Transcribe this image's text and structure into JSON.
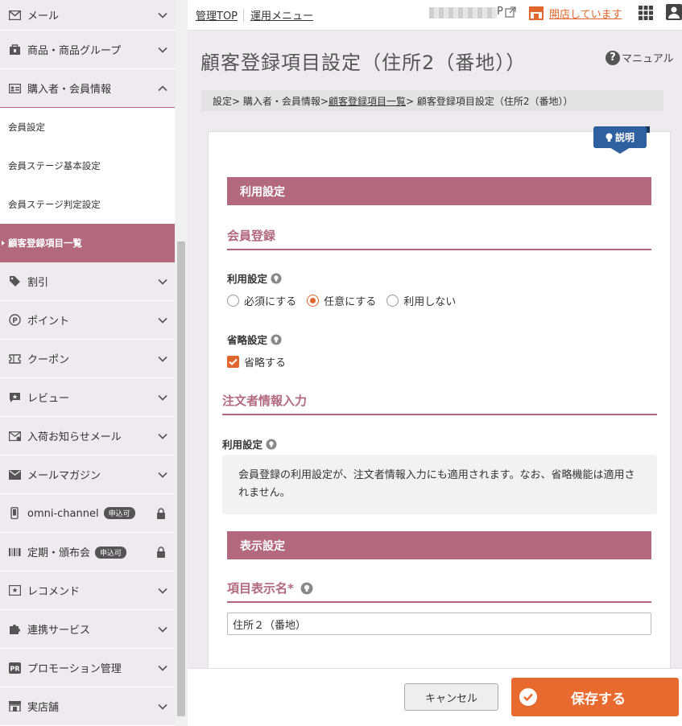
{
  "sidebar": {
    "items_top": [
      {
        "label": "メール",
        "icon": "mail-icon"
      },
      {
        "label": "商品・商品グループ",
        "icon": "product-bag-icon"
      },
      {
        "label": "購入者・会員情報",
        "icon": "member-card-icon"
      }
    ],
    "sub_items": [
      {
        "label": "会員設定"
      },
      {
        "label": "会員ステージ基本設定"
      },
      {
        "label": "会員ステージ判定設定"
      },
      {
        "label": "顧客登録項目一覧"
      }
    ],
    "items_bottom": [
      {
        "label": "割引",
        "icon": "tag-icon"
      },
      {
        "label": "ポイント",
        "icon": "point-icon"
      },
      {
        "label": "クーポン",
        "icon": "coupon-icon"
      },
      {
        "label": "レビュー",
        "icon": "review-icon"
      },
      {
        "label": "入荷お知らせメール",
        "icon": "restock-mail-icon"
      },
      {
        "label": "メールマガジン",
        "icon": "mail-magazine-icon"
      },
      {
        "label": "omni-channel",
        "icon": "phone-icon",
        "badge": "申込可"
      },
      {
        "label": "定期・頒布会",
        "icon": "subscription-icon",
        "badge": "申込可"
      },
      {
        "label": "レコメンド",
        "icon": "recommend-icon"
      },
      {
        "label": "連携サービス",
        "icon": "puzzle-icon"
      },
      {
        "label": "プロモーション管理",
        "icon": "pr-icon"
      },
      {
        "label": "実店舗",
        "icon": "store-front-icon"
      }
    ]
  },
  "topbar": {
    "admin_top": "管理TOP",
    "operations_menu": "運用メニュー",
    "shop_suffix": "P",
    "store_status": "開店しています"
  },
  "header": {
    "title": "顧客登録項目設定（住所2（番地））",
    "manual": "マニュアル"
  },
  "breadcrumb": {
    "part1": "設定> 購入者・会員情報> ",
    "link": "顧客登録項目一覧",
    "part2": "> 顧客登録項目設定（住所2（番地））"
  },
  "help_tag": "説明",
  "usage_section": {
    "title": "利用設定",
    "member_registration": {
      "heading": "会員登録",
      "usage_label": "利用設定",
      "radio_options": [
        "必須にする",
        "任意にする",
        "利用しない"
      ],
      "selected": "任意にする",
      "omit_label": "省略設定",
      "omit_checkbox": "省略する",
      "omit_checked": true
    },
    "order_info": {
      "heading": "注文者情報入力",
      "usage_label": "利用設定",
      "note": "会員登録の利用設定が、注文者情報入力にも適用されます。なお、省略機能は適用されません。"
    }
  },
  "display_section": {
    "title": "表示設定",
    "display_name_label": "項目表示名*",
    "display_name_value": "住所２（番地）"
  },
  "footer": {
    "cancel": "キャンセル",
    "save": "保存する"
  },
  "colors": {
    "accent": "#b2697d",
    "orange": "#e0662d",
    "help_blue": "#2e5f9e"
  }
}
